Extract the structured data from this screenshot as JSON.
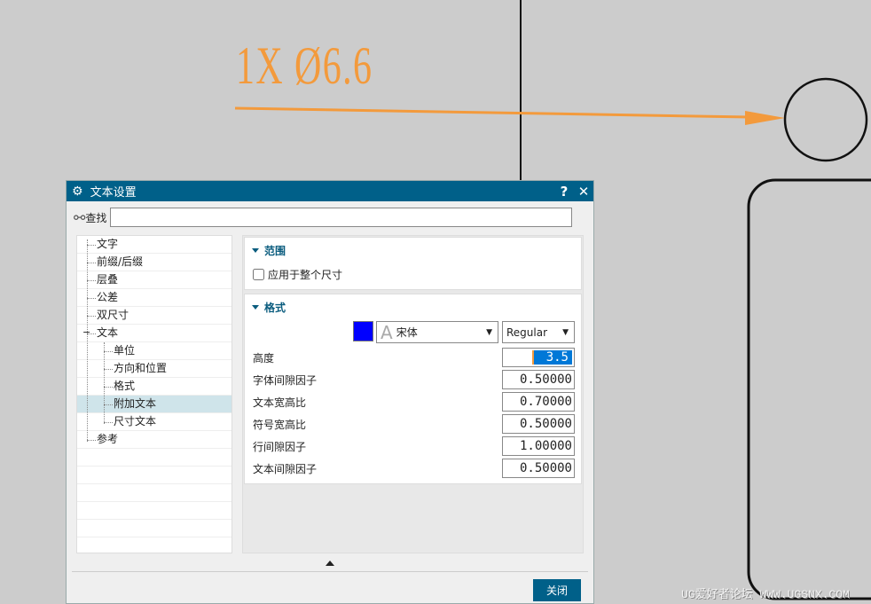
{
  "drawing": {
    "dimension_text": "1X Ø6.6",
    "watermark": "UG爱好者论坛 WWW.UGSNX.COM",
    "leader_color": "#f39a3c"
  },
  "dialog": {
    "title": "文本设置",
    "help": "?",
    "close_x": "✕",
    "search_label": "查找",
    "search_value": "",
    "tree": [
      {
        "label": "文字",
        "level": 0
      },
      {
        "label": "前缀/后缀",
        "level": 0
      },
      {
        "label": "层叠",
        "level": 0
      },
      {
        "label": "公差",
        "level": 0
      },
      {
        "label": "双尺寸",
        "level": 0
      },
      {
        "label": "文本",
        "level": 0,
        "expanded": true
      },
      {
        "label": "单位",
        "level": 1
      },
      {
        "label": "方向和位置",
        "level": 1
      },
      {
        "label": "格式",
        "level": 1
      },
      {
        "label": "附加文本",
        "level": 1,
        "selected": true
      },
      {
        "label": "尺寸文本",
        "level": 1
      },
      {
        "label": "参考",
        "level": 0
      }
    ],
    "range": {
      "title": "范围",
      "checkbox_label": "应用于整个尺寸",
      "checked": false
    },
    "format": {
      "title": "格式",
      "color": "#0000ff",
      "font": "宋体",
      "style": "Regular",
      "fields": [
        {
          "label": "高度",
          "value": "3.5"
        },
        {
          "label": "字体间隙因子",
          "value": "0.50000"
        },
        {
          "label": "文本宽高比",
          "value": "0.70000"
        },
        {
          "label": "符号宽高比",
          "value": "0.50000"
        },
        {
          "label": "行间隙因子",
          "value": "1.00000"
        },
        {
          "label": "文本间隙因子",
          "value": "0.50000"
        }
      ]
    },
    "close_button": "关闭"
  }
}
